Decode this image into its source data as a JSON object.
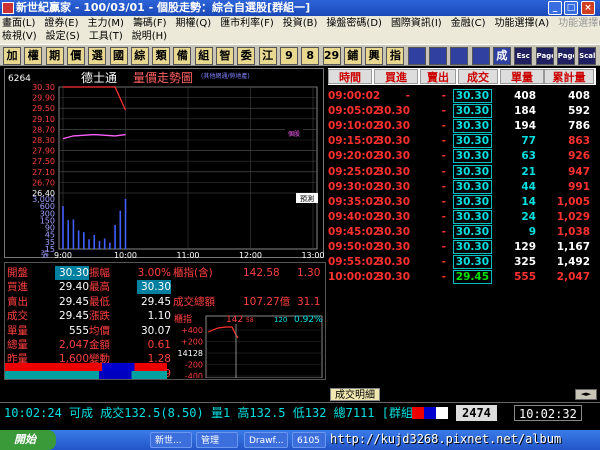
{
  "window": {
    "title": "新世紀贏家 - 100/03/01 - 個股走勢：綜合自選股[群組一]"
  },
  "menu": {
    "row1": [
      "畫面(L)",
      "證券(E)",
      "主力(M)",
      "籌碼(F)",
      "期權(Q)",
      "匯市利率(F)",
      "投資(B)",
      "操盤密碼(D)",
      "國際資訊(I)",
      "金融(C)",
      "功能選擇(A)",
      "功能選擇(A)"
    ],
    "row2": [
      "檢視(V)",
      "設定(S)",
      "工具(T)",
      "說明(H)"
    ]
  },
  "toolbar": [
    "加",
    "權",
    "期",
    "價",
    "選",
    "國",
    "綜",
    "類",
    "備",
    "組",
    "智",
    "委",
    "江",
    "9",
    "8",
    "29",
    "鋪",
    "興",
    "指",
    "",
    "",
    "",
    "",
    "成",
    "Esc",
    "Page",
    "Page",
    "Scale"
  ],
  "stock": {
    "code": "6264",
    "name": "德士通",
    "chart_title": "量價走勢圖",
    "note": "(其他網通/勞地產)",
    "tag_right": "個股",
    "tag_right2": "預測"
  },
  "chart_data": {
    "type": "line",
    "title": "量價走勢圖",
    "price_ticks": [
      "30.30",
      "29.90",
      "29.50",
      "29.10",
      "28.70",
      "28.30",
      "27.90",
      "27.50",
      "27.10",
      "26.70",
      "26.40"
    ],
    "volume_ticks": [
      "3,000",
      "600",
      "300",
      "150",
      "90",
      "45",
      "35",
      "15"
    ],
    "volume_unit": "張",
    "x_ticks": [
      "9:00",
      "10:00",
      "11:00",
      "12:00",
      "13:00"
    ],
    "ylim": [
      26.4,
      30.3
    ],
    "price": [
      [
        0,
        30.3
      ],
      [
        10,
        30.3
      ],
      [
        30,
        30.3
      ],
      [
        50,
        30.3
      ],
      [
        60,
        29.45
      ]
    ],
    "avg": [
      [
        0,
        28.4
      ],
      [
        10,
        28.5
      ],
      [
        30,
        28.55
      ],
      [
        50,
        28.5
      ],
      [
        60,
        28.55
      ]
    ],
    "volume": [
      408,
      184,
      194,
      77,
      63,
      21,
      44,
      14,
      24,
      9,
      129,
      325,
      555
    ]
  },
  "ticks": {
    "headers": [
      "時間",
      "買進",
      "賣出",
      "成交",
      "單量",
      "累計量"
    ],
    "rows": [
      {
        "time": "09:00:02",
        "bid": "-",
        "ask": "-",
        "price": "30.30",
        "vol": "408",
        "total": "408"
      },
      {
        "time": "09:05:02",
        "bid": "30.30",
        "ask": "-",
        "price": "30.30",
        "vol": "184",
        "total": "592"
      },
      {
        "time": "09:10:02",
        "bid": "30.30",
        "ask": "-",
        "price": "30.30",
        "vol": "194",
        "total": "786"
      },
      {
        "time": "09:15:02",
        "bid": "30.30",
        "ask": "-",
        "price": "30.30",
        "vol": "77",
        "total": "863"
      },
      {
        "time": "09:20:02",
        "bid": "30.30",
        "ask": "-",
        "price": "30.30",
        "vol": "63",
        "total": "926"
      },
      {
        "time": "09:25:02",
        "bid": "30.30",
        "ask": "-",
        "price": "30.30",
        "vol": "21",
        "total": "947"
      },
      {
        "time": "09:30:02",
        "bid": "30.30",
        "ask": "-",
        "price": "30.30",
        "vol": "44",
        "total": "991"
      },
      {
        "time": "09:35:02",
        "bid": "30.30",
        "ask": "-",
        "price": "30.30",
        "vol": "14",
        "total": "1,005"
      },
      {
        "time": "09:40:02",
        "bid": "30.30",
        "ask": "-",
        "price": "30.30",
        "vol": "24",
        "total": "1,029"
      },
      {
        "time": "09:45:02",
        "bid": "30.30",
        "ask": "-",
        "price": "30.30",
        "vol": "9",
        "total": "1,038"
      },
      {
        "time": "09:50:02",
        "bid": "30.30",
        "ask": "-",
        "price": "30.30",
        "vol": "129",
        "total": "1,167"
      },
      {
        "time": "09:55:02",
        "bid": "30.30",
        "ask": "-",
        "price": "30.30",
        "vol": "325",
        "total": "1,492"
      },
      {
        "time": "10:00:02",
        "bid": "30.30",
        "ask": "-",
        "price": "29.45",
        "vol": "555",
        "total": "2,047"
      }
    ]
  },
  "quote": {
    "rows": [
      [
        [
          "開盤",
          "#ff4040"
        ],
        [
          "30.30",
          "#ff4040"
        ],
        [
          "振幅",
          "#ff4040"
        ],
        [
          "3.00%",
          "#ff4040"
        ],
        [
          "櫃指(含)",
          "#ff4040"
        ],
        [
          "142.58",
          "#ff4040"
        ],
        [
          "1.30",
          "#ff4040"
        ]
      ],
      [
        [
          "買進",
          "#ff4040"
        ],
        [
          "29.40",
          "#fff"
        ],
        [
          "最高",
          "#ff4040"
        ],
        [
          "30.30",
          "#fff"
        ],
        [
          "",
          "#fff"
        ],
        [
          "",
          "#fff"
        ],
        [
          "",
          "#fff"
        ]
      ],
      [
        [
          "賣出",
          "#ff4040"
        ],
        [
          "29.45",
          "#fff"
        ],
        [
          "最低",
          "#ff4040"
        ],
        [
          "29.45",
          "#fff"
        ],
        [
          "成交總額",
          "#ff4040"
        ],
        [
          "107.27億",
          "#ff4040"
        ],
        [
          "31.1",
          "#ff4040"
        ]
      ],
      [
        [
          "成交",
          "#ff4040"
        ],
        [
          "29.45",
          "#fff"
        ],
        [
          "漲跌",
          "#ff4040"
        ],
        [
          "1.10",
          "#fff"
        ],
        [
          "",
          "#fff"
        ],
        [
          "",
          "#fff"
        ],
        [
          "",
          "#fff"
        ]
      ],
      [
        [
          "單量",
          "#ff4040"
        ],
        [
          "555",
          "#fff"
        ],
        [
          "均價",
          "#ff4040"
        ],
        [
          "30.07",
          "#fff"
        ],
        [
          "",
          "#fff"
        ],
        [
          "",
          "#fff"
        ],
        [
          "",
          "#fff"
        ]
      ],
      [
        [
          "總量",
          "#ff4040"
        ],
        [
          "2,047",
          "#ff4040"
        ],
        [
          "金額",
          "#ff4040"
        ],
        [
          "0.61",
          "#ff4040"
        ],
        [
          "",
          "#fff"
        ],
        [
          "",
          "#fff"
        ],
        [
          "",
          "#fff"
        ]
      ],
      [
        [
          "昨量",
          "#ff4040"
        ],
        [
          "1,600",
          "#ff4040"
        ],
        [
          "變動",
          "#ff4040"
        ],
        [
          "1.28",
          "#ff4040"
        ],
        [
          "",
          "#fff"
        ],
        [
          "",
          "#fff"
        ],
        [
          "",
          "#fff"
        ]
      ],
      [
        [
          "買量",
          "#ff4040"
        ],
        [
          "1",
          "#ff4040"
        ],
        [
          "賣量",
          "#ff4040"
        ],
        [
          "9",
          "#ff4040"
        ],
        [
          "",
          "#fff"
        ],
        [
          "",
          "#fff"
        ],
        [
          "",
          "#fff"
        ]
      ]
    ]
  },
  "mini": {
    "label": "櫃指",
    "value": "142",
    "value_small": "58",
    "change": "120",
    "pct": "0.92%",
    "ticks": [
      "+400",
      "+200",
      "14128",
      "-200",
      "-400"
    ]
  },
  "tab": {
    "label": "成交明細"
  },
  "status": {
    "left": "10:02:24 可成 成交132.5(8.50) 量1 高132.5 低132 總7111 [群組一]",
    "code": "2474",
    "time": "10:02:32"
  },
  "taskbar": {
    "start": "開始",
    "tasks": [
      "新世...",
      "管理",
      "Drawf...",
      "6105"
    ]
  },
  "watermark": "http://kujd3268.pixnet.net/album"
}
